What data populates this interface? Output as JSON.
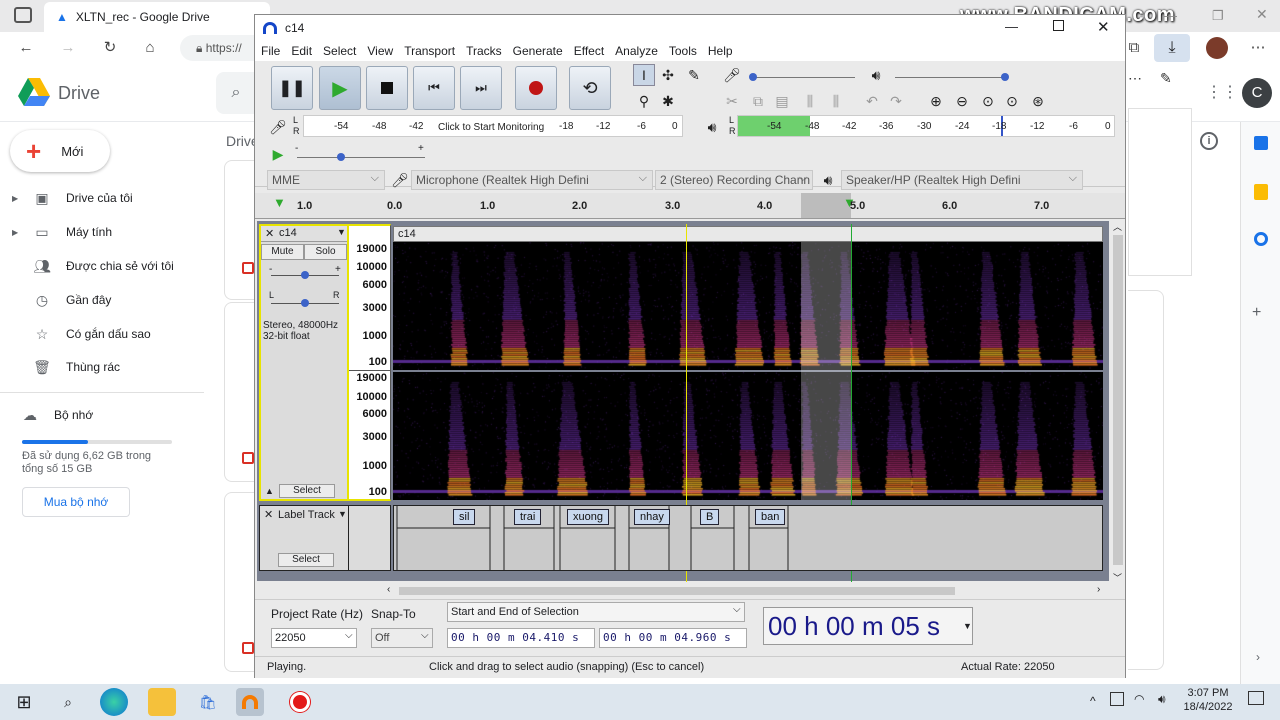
{
  "browser": {
    "tab_title": "XLTN_rec - Google Drive",
    "address_text": "https://",
    "watermark": "www.BANDICAM.com"
  },
  "drive": {
    "logo_text": "Drive",
    "new_button": "Mới",
    "breadcrumb": "Drive",
    "nav": [
      "Drive của tôi",
      "Máy tính",
      "Được chia sẻ với tôi",
      "Gần đây",
      "Có gắn dấu sao",
      "Thùng rác"
    ],
    "storage_label": "Bộ nhớ",
    "storage_text": "Đã sử dụng 6,62 GB trong tổng số 15 GB",
    "storage_fraction": 0.44,
    "buy_storage": "Mua bộ nhớ",
    "avatar_letter": "C"
  },
  "audacity": {
    "title": "c14",
    "menu": [
      "File",
      "Edit",
      "Select",
      "View",
      "Transport",
      "Tracks",
      "Generate",
      "Effect",
      "Analyze",
      "Tools",
      "Help"
    ],
    "rec_meter_ticks": [
      "-54",
      "-48",
      "-42",
      "-18",
      "-12",
      "-6",
      "0"
    ],
    "monitor_text": "Click to Start Monitoring",
    "play_meter_ticks": [
      "-54",
      "-48",
      "-42",
      "-36",
      "-30",
      "-24",
      "-18",
      "-12",
      "-6",
      "0"
    ],
    "host": "MME",
    "rec_device": "Microphone (Realtek High Defini",
    "channels": "2 (Stereo) Recording Chann",
    "play_device": "Speaker/HP (Realtek High Defini",
    "timeline": [
      "1.0",
      "0.0",
      "1.0",
      "2.0",
      "3.0",
      "4.0",
      "5.0",
      "6.0",
      "7.0"
    ],
    "track": {
      "name": "c14",
      "mute": "Mute",
      "solo": "Solo",
      "info_rate": "Stereo, 48000Hz",
      "info_fmt": "32-bit float",
      "select": "Select",
      "clip_name": "c14",
      "hz_labels": [
        "19000",
        "10000",
        "6000",
        "3000",
        "1000",
        "100"
      ]
    },
    "label_track": {
      "name": "Label Track",
      "select": "Select",
      "labels": [
        "sil",
        "trai",
        "xuong",
        "nhay",
        "B",
        "ban"
      ]
    },
    "project_rate_label": "Project Rate (Hz)",
    "project_rate": "22050",
    "snap_label": "Snap-To",
    "snap_value": "Off",
    "selection_mode": "Start and End of Selection",
    "sel_start": "00 h 00 m 04.410 s",
    "sel_end": "00 h 00 m 04.960 s",
    "big_time": "00 h 00 m 05 s",
    "status_left": "Playing.",
    "status_mid": "Click and drag to select audio (snapping) (Esc to cancel)",
    "status_right": "Actual Rate: 22050"
  },
  "taskbar": {
    "time": "3:07 PM",
    "date": "18/4/2022"
  },
  "colors": {
    "accent": "#1a73e8",
    "audacity_bg": "#eaeaea",
    "meter_green": "#6ed06e"
  }
}
